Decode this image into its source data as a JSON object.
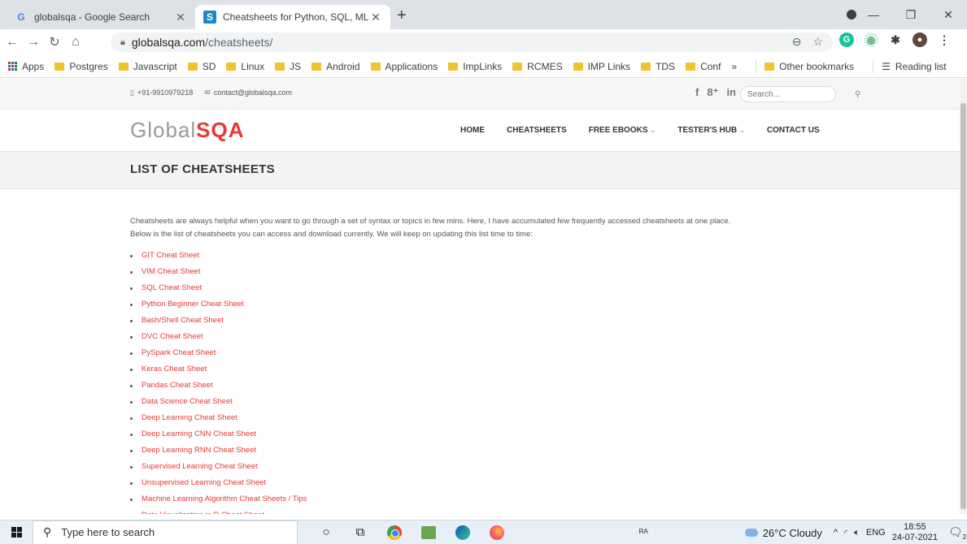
{
  "browser": {
    "tabs": [
      {
        "title": "globalsqa - Google Search",
        "favicon": "google-icon",
        "active": false
      },
      {
        "title": "Cheatsheets for Python, SQL, ML",
        "favicon": "globalsqa-icon",
        "active": true
      }
    ],
    "url_host": "globalsqa.com",
    "url_path": "/cheatsheets/",
    "bookmarks": [
      "Apps",
      "Postgres",
      "Javascript",
      "SD",
      "Linux",
      "JS",
      "Android",
      "Applications",
      "ImpLinks",
      "RCMES",
      "IMP Links",
      "TDS",
      "Conf"
    ],
    "bookmarks_overflow": "»",
    "other_bookmarks": "Other bookmarks",
    "reading_list": "Reading list"
  },
  "site": {
    "phone": "+91-9910979218",
    "email": "contact@globalsqa.com",
    "social_icons": [
      "facebook-icon",
      "googleplus-icon",
      "linkedin-icon",
      "twitter-icon",
      "pinterest-icon"
    ],
    "search_placeholder": "Search...",
    "logo_text_gray": "Global",
    "logo_text_red": "SQA",
    "menu": [
      {
        "label": "HOME",
        "dropdown": false
      },
      {
        "label": "CHEATSHEETS",
        "dropdown": false
      },
      {
        "label": "FREE EBOOKS",
        "dropdown": true
      },
      {
        "label": "TESTER'S HUB",
        "dropdown": true
      },
      {
        "label": "CONTACT US",
        "dropdown": false
      }
    ],
    "page_title": "LIST OF CHEATSHEETS",
    "intro_line1": "Cheatsheets are always helpful when you want to go through a set of syntax or topics in few mins. Here, I have accumulated few frequently accessed cheatsheets at one place.",
    "intro_line2": "Below is the list of cheatsheets you can access and download currently. We will keep on updating this list time to time:",
    "cheatsheets": [
      "GIT Cheat Sheet",
      "VIM Cheat Sheet",
      "SQL Cheat Sheet",
      "Python Beginner Cheat Sheet",
      "Bash/Shell Cheat Sheet",
      "DVC Cheat Sheet",
      "PySpark Cheat Sheet",
      "Keras Cheat Sheet",
      "Pandas Cheat Sheet",
      "Data Science Cheat Sheet",
      "Deep Learning Cheat Sheet",
      "Deep Learning CNN Cheat Sheet",
      "Deep Learning RNN Cheat Sheet",
      "Supervised Learning Cheat Sheet",
      "Unsupervised Learning Cheat Sheet",
      "Machine Learning Algorithm Cheat Sheets / Tips",
      "Data Visualization in R Cheat Sheet"
    ],
    "link_color": "#e53935"
  },
  "taskbar": {
    "search_placeholder": "Type here to search",
    "weather": "26°C Cloudy",
    "language": "ENG",
    "time": "18:55",
    "date": "24-07-2021",
    "notification_count": "2"
  }
}
